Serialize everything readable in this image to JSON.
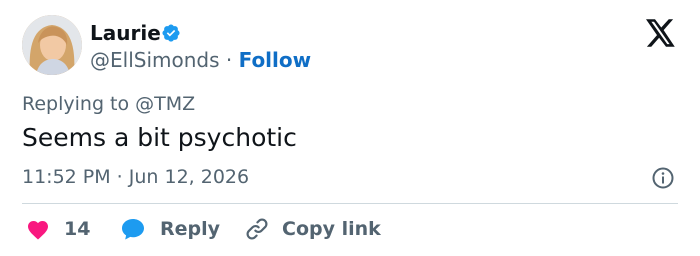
{
  "author": {
    "name": "Laurie",
    "handle": "@EllSimonds",
    "separator": "·",
    "follow_label": "Follow"
  },
  "reply_context": {
    "prefix": "Replying to",
    "mention": "@TMZ"
  },
  "tweet": {
    "text": "Seems a bit psychotic",
    "timestamp": "11:52 PM · Jun 12, 2026"
  },
  "actions": {
    "likes_count": "14",
    "reply_label": "Reply",
    "copy_link_label": "Copy link"
  },
  "icons": {
    "verified": "verified-badge-icon",
    "x_logo": "x-logo-icon",
    "info": "info-icon",
    "heart": "heart-icon",
    "reply": "speech-bubble-icon",
    "link": "link-icon"
  },
  "colors": {
    "verified_blue": "#1d9bf0",
    "follow_blue": "#0f6ec6",
    "heart_pink": "#f91880",
    "reply_blue": "#1d9bf0",
    "muted_text": "#536471"
  }
}
